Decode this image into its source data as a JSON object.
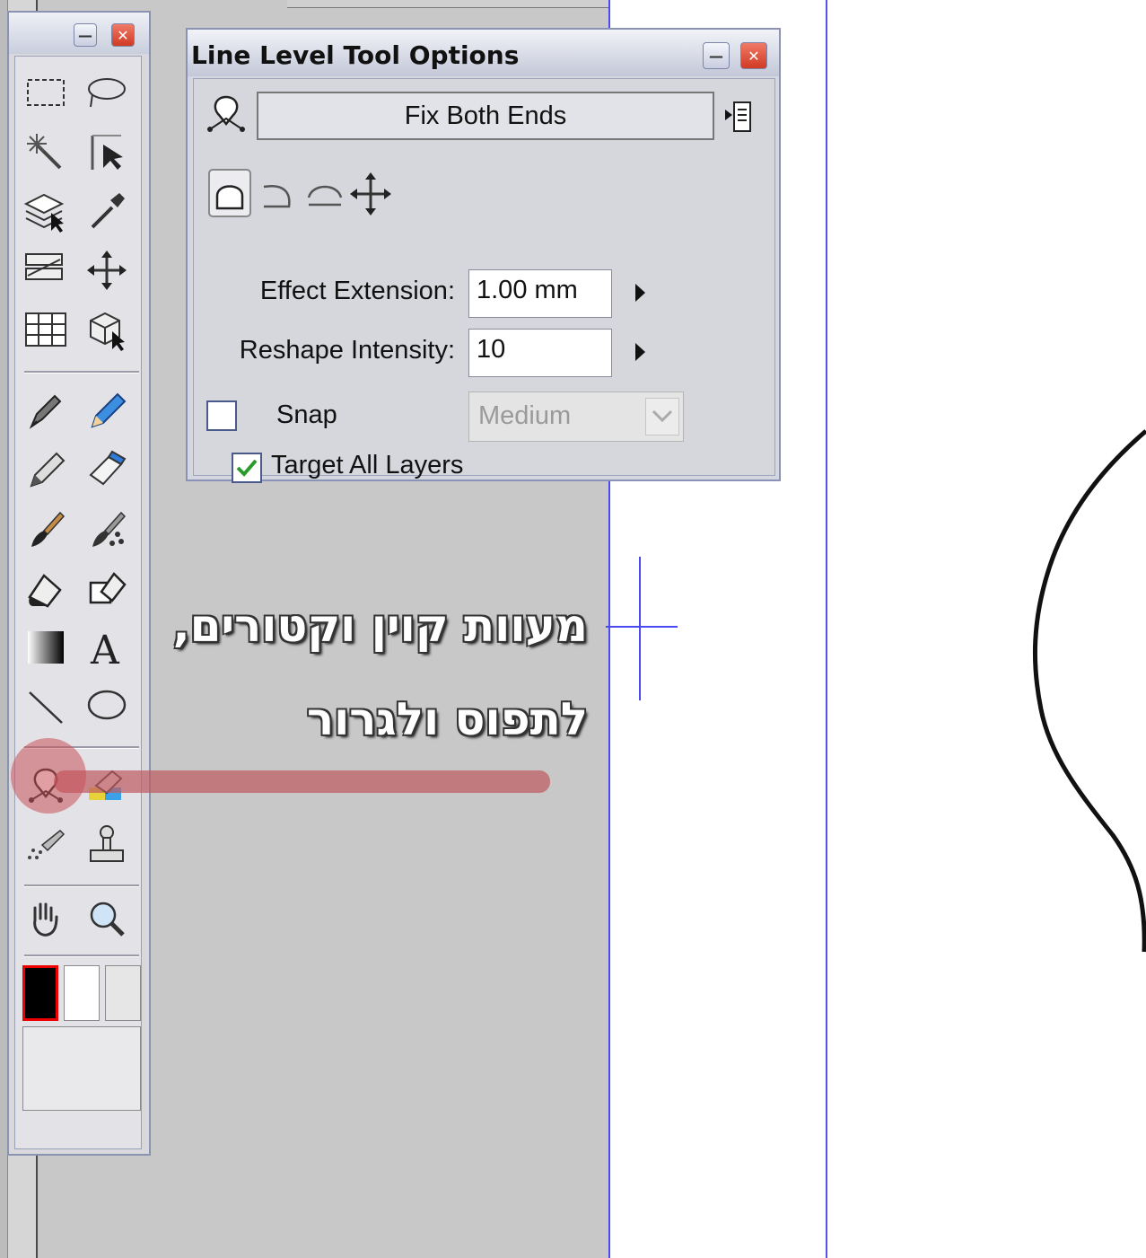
{
  "dialog": {
    "title": "Line Level Tool Options",
    "mode_dropdown_value": "Fix Both Ends",
    "mode_buttons": [
      "arch-icon",
      "hook-icon",
      "flat-arch-icon",
      "move-icon"
    ],
    "effect_extension": {
      "label": "Effect Extension:",
      "value": "1.00 mm"
    },
    "reshape_intensity": {
      "label": "Reshape Intensity:",
      "value": "10"
    },
    "snap": {
      "label": "Snap",
      "checked": false,
      "select_value": "Medium"
    },
    "target_all_layers": {
      "label": "Target All Layers",
      "checked": true
    }
  },
  "toolbox": {
    "tools": [
      "rect-select-icon",
      "lasso-icon",
      "magic-wand-icon",
      "object-select-icon",
      "layer-select-icon",
      "eyedropper-icon",
      "layer-move-icon",
      "move-icon",
      "grid-icon",
      "3d-box-icon",
      "pen-icon",
      "pencil-icon",
      "marker-icon",
      "eraser-icon",
      "brush-icon",
      "spray-brush-icon",
      "fill-icon",
      "fill-outline-icon",
      "gradient-icon",
      "text-icon",
      "line-icon",
      "ellipse-icon",
      "line-level-icon",
      "color-change-icon",
      "airbrush-icon",
      "stamp-icon",
      "hand-icon",
      "zoom-icon"
    ],
    "colors": {
      "main": "#000000",
      "sub": "#ffffff",
      "highlight": "#ff0000"
    }
  },
  "annotation": {
    "line1": "מעוות קוין וקטורים,",
    "line2": "לתפוס ולגרור"
  },
  "colors": {
    "guide_blue": "#4a4af0",
    "highlight_red": "#c0505a"
  }
}
